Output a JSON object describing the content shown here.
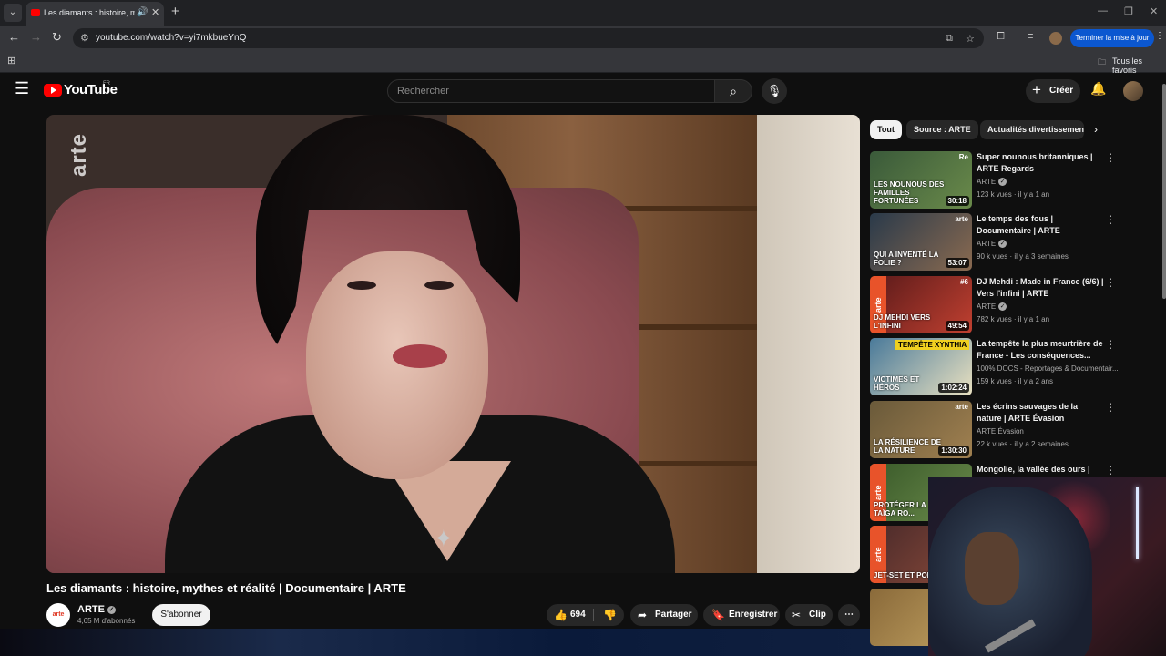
{
  "browser": {
    "tab_title": "Les diamants : histoire, mythes et réalité | Documentaire | ARTE",
    "url": "youtube.com/watch?v=yi7mkbueYnQ",
    "update_button": "Terminer la mise à jour",
    "bookmarks_all": "Tous les favoris"
  },
  "header": {
    "logo_text": "YouTube",
    "country": "FR",
    "search_placeholder": "Rechercher",
    "create_label": "Créer"
  },
  "video": {
    "title": "Les diamants : histoire, mythes et réalité | Documentaire | ARTE",
    "watermark": "arte",
    "channel": "ARTE",
    "channel_avatar_text": "arte",
    "subscribers": "4,65 M d'abonnés",
    "subscribe_label": "S'abonner",
    "likes": "694",
    "share_label": "Partager",
    "save_label": "Enregistrer",
    "clip_label": "Clip"
  },
  "chips": [
    "Tout",
    "Source : ARTE",
    "Actualités divertissement"
  ],
  "recommendations": [
    {
      "title": "Super nounous britanniques | ARTE Regards",
      "channel": "ARTE",
      "verified": true,
      "meta": "123 k vues · il y a 1 an",
      "duration": "30:18",
      "thumb_text": "LES NOUNOUS DES FAMILLES FORTUNÉES",
      "thumb_corner": "Re",
      "colors": [
        "#3a5a3a",
        "#6a8a4a"
      ]
    },
    {
      "title": "Le temps des fous | Documentaire | ARTE",
      "channel": "ARTE",
      "verified": true,
      "meta": "90 k vues · il y a 3 semaines",
      "duration": "53:07",
      "thumb_text": "QUI A INVENTÉ LA FOLIE ?",
      "thumb_corner": "arte",
      "colors": [
        "#2a3a4a",
        "#8a6a50"
      ]
    },
    {
      "title": "DJ Mehdi : Made in France (6/6) | Vers l'infini | ARTE",
      "channel": "ARTE",
      "verified": true,
      "meta": "782 k vues · il y a 1 an",
      "duration": "49:54",
      "thumb_text": "DJ MEHDI VERS L'INFINI",
      "thumb_corner": "#6",
      "colors": [
        "#5a1a1a",
        "#c04030"
      ]
    },
    {
      "title": "La tempête la plus meurtrière de France - Les conséquences...",
      "channel": "100% DOCS - Reportages & Documentair...",
      "verified": false,
      "meta": "159 k vues · il y a 2 ans",
      "duration": "1:02:24",
      "thumb_text": "VICTIMES ET HÉROS",
      "thumb_banner": "TEMPÊTE XYNTHIA",
      "colors": [
        "#4a7a9a",
        "#e8e0c0"
      ]
    },
    {
      "title": "Les écrins sauvages de la nature | ARTE Évasion",
      "channel": "ARTE Évasion",
      "verified": false,
      "meta": "22 k vues · il y a 2 semaines",
      "duration": "1:30:30",
      "thumb_text": "LA RÉSILIENCE DE LA NATURE",
      "thumb_corner": "arte",
      "colors": [
        "#6a5a3a",
        "#a08050"
      ]
    },
    {
      "title": "Mongolie, la vallée des ours | ARTE",
      "channel": "",
      "verified": false,
      "meta": "",
      "duration": "",
      "thumb_text": "PROTÉGER LA TAÏGA RO...",
      "colors": [
        "#3a5a2a",
        "#6a8a4a"
      ]
    },
    {
      "title": "",
      "channel": "",
      "verified": false,
      "meta": "",
      "duration": "",
      "thumb_text": "JET-SET ET PORNO",
      "colors": [
        "#4a2a2a",
        "#8a4a3a"
      ]
    },
    {
      "title": "",
      "channel": "",
      "verified": false,
      "meta": "",
      "duration": "",
      "thumb_text": "",
      "colors": [
        "#8a6a3a",
        "#c0a060"
      ]
    }
  ],
  "colors": {
    "youtube_red": "#ff0000",
    "arte_orange": "#e8532a",
    "chrome_blue": "#0b57d0"
  },
  "icons": [
    "menu-icon",
    "search-icon",
    "mic-icon",
    "bell-icon",
    "like-icon",
    "dislike-icon",
    "share-icon",
    "save-icon",
    "clip-icon",
    "more-icon",
    "chevron-right-icon"
  ]
}
